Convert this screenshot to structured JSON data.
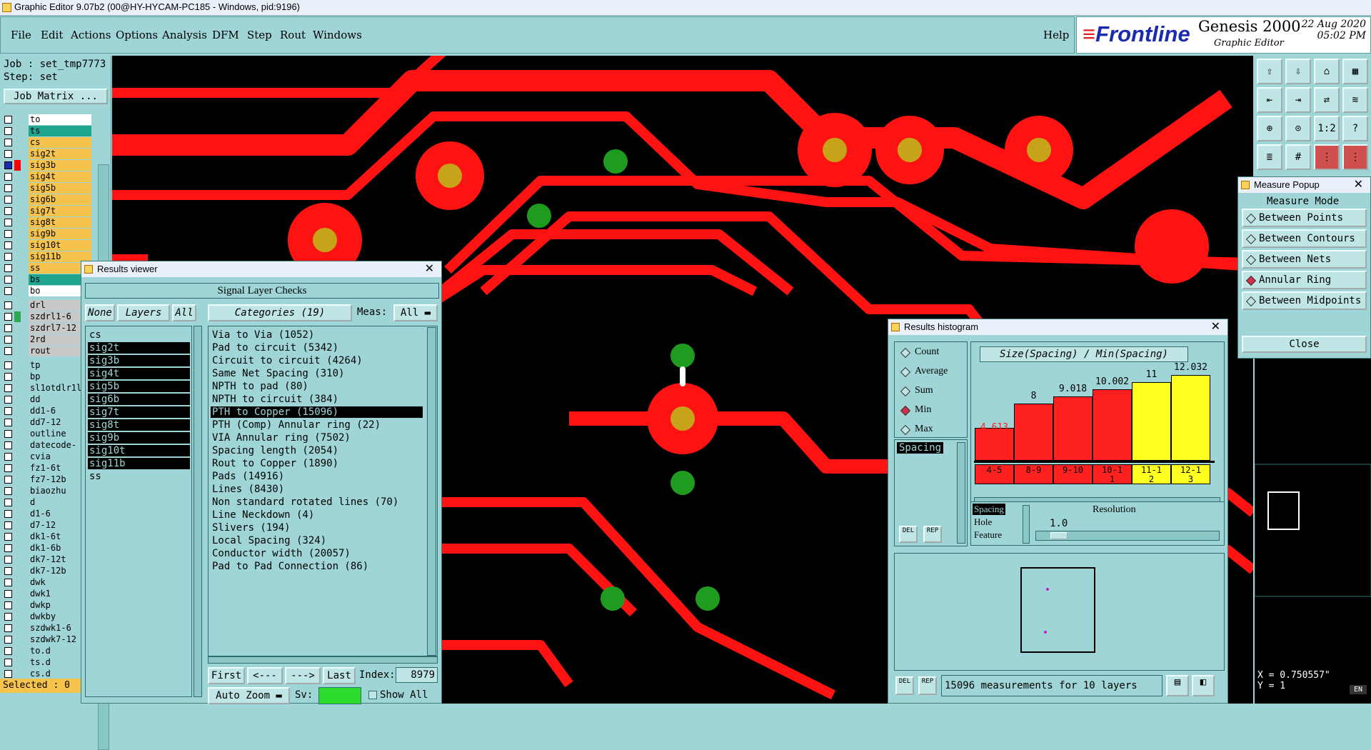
{
  "app": {
    "title": "Graphic Editor 9.07b2 (00@HY-HYCAM-PC185 - Windows, pid:9196)"
  },
  "menu": {
    "items": [
      "File",
      "Edit",
      "Actions",
      "Options",
      "Analysis",
      "DFM",
      "Step",
      "Rout",
      "Windows"
    ],
    "help": "Help"
  },
  "brand": {
    "logo": "Frontline",
    "product": "Genesis 2000",
    "subtitle": "Graphic Editor",
    "date": "22 Aug 2020",
    "time": "05:02 PM"
  },
  "left": {
    "job": "Job : set_tmp7773",
    "step": "Step: set",
    "job_matrix": "Job Matrix ...",
    "selected": "Selected : 0",
    "layers": [
      {
        "name": "to",
        "color": "#ffffff"
      },
      {
        "name": "ts",
        "color": "#1fa58e"
      },
      {
        "name": "cs",
        "color": "#f6c44d"
      },
      {
        "name": "sig2t",
        "color": "#f6c44d"
      },
      {
        "name": "sig3b",
        "color": "#f6c44d",
        "marker": "#ff0000",
        "sel": true
      },
      {
        "name": "sig4t",
        "color": "#f6c44d"
      },
      {
        "name": "sig5b",
        "color": "#f6c44d"
      },
      {
        "name": "sig6b",
        "color": "#f6c44d"
      },
      {
        "name": "sig7t",
        "color": "#f6c44d"
      },
      {
        "name": "sig8t",
        "color": "#f6c44d"
      },
      {
        "name": "sig9b",
        "color": "#f6c44d"
      },
      {
        "name": "sig10t",
        "color": "#f6c44d"
      },
      {
        "name": "sig11b",
        "color": "#f6c44d"
      },
      {
        "name": "ss",
        "color": "#f6c44d"
      },
      {
        "name": "bs",
        "color": "#1fa58e"
      },
      {
        "name": "bo",
        "color": "#ffffff"
      }
    ],
    "drill_layers": [
      {
        "name": "drl",
        "color": "#c8c8c8"
      },
      {
        "name": "szdrl1-6",
        "color": "#c8c8c8",
        "marker": "#2fa84f"
      },
      {
        "name": "szdrl7-12",
        "color": "#c8c8c8"
      },
      {
        "name": "2rd",
        "color": "#c8c8c8"
      },
      {
        "name": "rout",
        "color": "#c8c8c8"
      }
    ],
    "misc_layers": [
      "tp",
      "bp",
      "sl1otdlr1l",
      "dd",
      "dd1-6",
      "dd7-12",
      "outline",
      "datecode-",
      "cvia",
      "fz1-6t",
      "fz7-12b",
      "biaozhu",
      "d",
      "d1-6",
      "d7-12",
      "dk1-6t",
      "dk1-6b",
      "dk7-12t",
      "dk7-12b",
      "dwk",
      "dwk1",
      "dwkp",
      "dwkby",
      "szdwk1-6",
      "szdwk7-12",
      "to.d",
      "ts.d",
      "cs.d"
    ]
  },
  "results_viewer": {
    "title": "Results viewer",
    "header": "Signal Layer Checks",
    "none": "None",
    "layers_btn": "Layers",
    "all": "All",
    "categories_btn": "Categories (19)",
    "meas_label": "Meas:",
    "meas_value": "All",
    "layer_list": [
      {
        "n": "cs",
        "s": false
      },
      {
        "n": "sig2t",
        "s": true
      },
      {
        "n": "sig3b",
        "s": true
      },
      {
        "n": "sig4t",
        "s": true
      },
      {
        "n": "sig5b",
        "s": true
      },
      {
        "n": "sig6b",
        "s": true
      },
      {
        "n": "sig7t",
        "s": true
      },
      {
        "n": "sig8t",
        "s": true
      },
      {
        "n": "sig9b",
        "s": true
      },
      {
        "n": "sig10t",
        "s": true
      },
      {
        "n": "sig11b",
        "s": true
      },
      {
        "n": "ss",
        "s": false
      }
    ],
    "categories": [
      "Via to Via (1052)",
      "Pad to circuit (5342)",
      "Circuit to circuit (4264)",
      "Same Net Spacing (310)",
      "NPTH to pad (80)",
      "NPTH to circuit (384)",
      "PTH to Copper (15096)",
      "PTH (Comp) Annular ring (22)",
      "VIA Annular ring (7502)",
      "Spacing length (2054)",
      "Rout to Copper (1890)",
      "Pads (14916)",
      "Lines (8430)",
      "Non standard rotated lines (70)",
      "Line Neckdown (4)",
      "Slivers (194)",
      "Local Spacing (324)",
      "Conductor width (20057)",
      "Pad to Pad Connection (86)"
    ],
    "selected_category": 6,
    "first": "First",
    "prev": "<---",
    "next": "--->",
    "last": "Last",
    "index_label": "Index:",
    "index_value": "8979",
    "auto_zoom": "Auto Zoom",
    "sv": "Sv:",
    "show_all": "Show All"
  },
  "histogram": {
    "title": "Results histogram",
    "modes": [
      "Count",
      "Average",
      "Sum",
      "Min",
      "Max"
    ],
    "selected_mode": 3,
    "chart_title": "Size(Spacing) / Min(Spacing)",
    "list_item": "Spacing",
    "resolution_label": "Resolution",
    "resolution_value": "1.0",
    "type_items": [
      "Spacing",
      "Hole",
      "Feature"
    ],
    "del": "DEL",
    "rep": "REP",
    "footer": "15096 measurements for 10 layers"
  },
  "chart_data": {
    "type": "bar",
    "title": "Size(Spacing) / Min(Spacing)",
    "categories": [
      "4-5",
      "8-9",
      "9-10",
      "10-11",
      "11-12",
      "12-13"
    ],
    "values": [
      4.613,
      8,
      9.018,
      10.002,
      11,
      12.032
    ],
    "value_labels": [
      "4.613",
      "8",
      "9.018",
      "10.002",
      "11",
      "12.032"
    ],
    "colors": [
      "#ff2020",
      "#ff2020",
      "#ff2020",
      "#ff2020",
      "#ffff20",
      "#ffff20"
    ]
  },
  "measure": {
    "title": "Measure Popup",
    "header": "Measure Mode",
    "modes": [
      "Between Points",
      "Between Contours",
      "Between Nets",
      "Annular Ring",
      "Between Midpoints"
    ],
    "selected": 3,
    "close": "Close"
  },
  "coords": {
    "x": "X = 0.750557\"",
    "y": "Y = 1"
  },
  "tools": {
    "ratio": "1:2",
    "help": "?"
  },
  "ime": "EN"
}
